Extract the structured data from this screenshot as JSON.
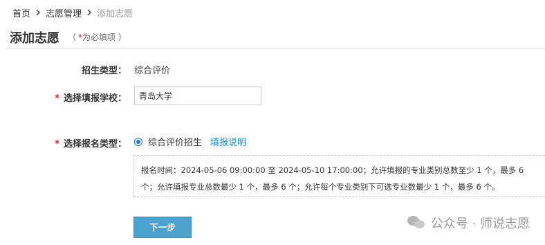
{
  "breadcrumb": {
    "home": "首页",
    "section": "志愿管理",
    "current": "添加志愿"
  },
  "page": {
    "title": "添加志愿",
    "required_prefix": "（",
    "required_star": "*",
    "required_text": "为必填项 ）"
  },
  "form": {
    "admission_type": {
      "label": "招生类型：",
      "value": "综合评价"
    },
    "school": {
      "star": "*",
      "label": "选择填报学校：",
      "value": "青岛大学"
    },
    "apply_type": {
      "star": "*",
      "label": "选择报名类型：",
      "option_label": "综合评价招生",
      "option_selected": true,
      "help_link": "填报说明"
    }
  },
  "info": {
    "line1": "报名时间：2024-05-06 09:00:00 至 2024-05-10 17:00:00；允许填报的专业类别总数至少 1 个，最多 6",
    "line2": "个；允许填报专业总数最少 1 个，最多 6 个；允许每个专业类别下可选专业数最少 1 个，最多 6 个。"
  },
  "actions": {
    "next_label": "下一步"
  },
  "watermark": {
    "text": "公众号 · 师说志愿",
    "icon": "wechat-icon"
  },
  "colors": {
    "accent": "#4aa3cc",
    "required": "#e02020",
    "link": "#1a8ad8"
  }
}
